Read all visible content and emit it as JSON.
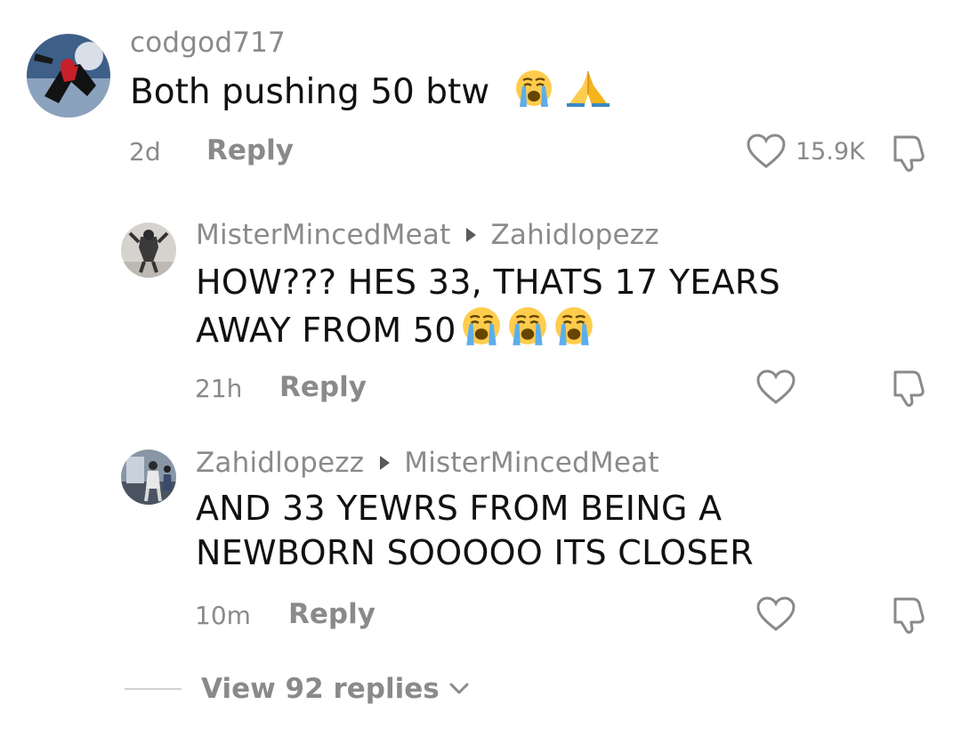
{
  "comments": [
    {
      "username": "codgod717",
      "reply_to": "",
      "text_lines": [
        "Both pushing 50 btw"
      ],
      "emojis": [
        "loudly-crying-face",
        "folded-hands"
      ],
      "time": "2d",
      "reply_label": "Reply",
      "like_count": "15.9K"
    },
    {
      "username": "MisterMincedMeat",
      "reply_to": "Zahidlopezz",
      "text_lines": [
        "HOW??? HES 33, THATS 17 YEARS",
        "AWAY FROM 50"
      ],
      "emojis": [
        "loudly-crying-face",
        "loudly-crying-face",
        "loudly-crying-face"
      ],
      "time": "21h",
      "reply_label": "Reply",
      "like_count": ""
    },
    {
      "username": "Zahidlopezz",
      "reply_to": "MisterMincedMeat",
      "text_lines": [
        "AND 33 YEWRS FROM BEING A",
        "NEWBORN SOOOOO ITS CLOSER"
      ],
      "emojis": [],
      "time": "10m",
      "reply_label": "Reply",
      "like_count": ""
    }
  ],
  "view_replies": {
    "label": "View 92 replies",
    "icon": "chevron-down-icon"
  },
  "colors": {
    "text": "#111111",
    "muted": "#8a8a8a",
    "background": "#ffffff"
  }
}
